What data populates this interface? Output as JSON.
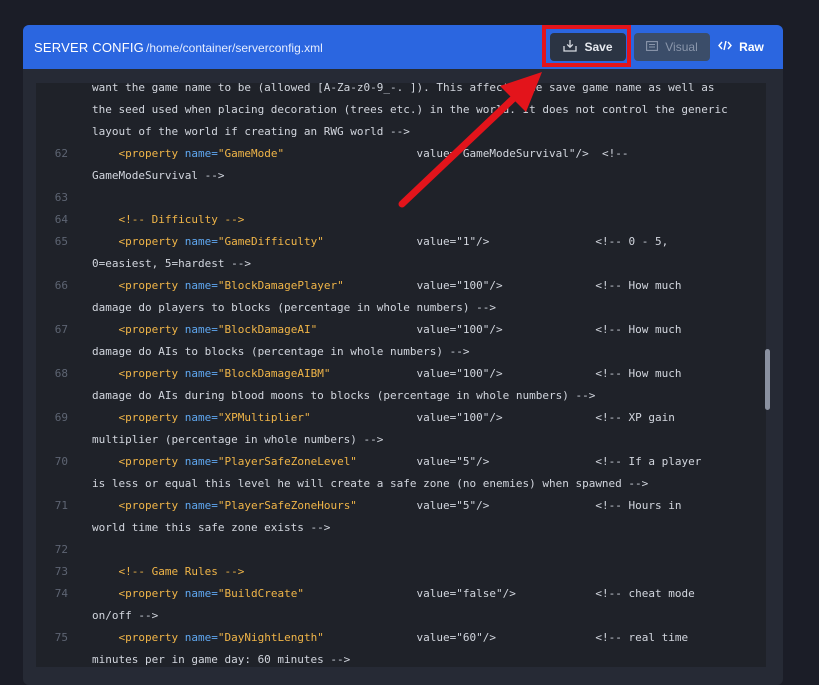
{
  "header": {
    "title": "SERVER CONFIG",
    "path": "/home/container/serverconfig.xml",
    "save_label": "Save",
    "visual_label": "Visual",
    "raw_label": "Raw"
  },
  "colors": {
    "header_bg": "#2b66e0",
    "highlight": "#e3141b",
    "tag": "#f0b548",
    "attr": "#5fa7f0"
  },
  "icons": [
    "save-icon",
    "visual-icon",
    "code-icon",
    "arrow-annotation"
  ],
  "lines": [
    {
      "num": "",
      "text": "want the game name to be (allowed [A-Za-z0-9_-. ]). This affects the save game name as well as"
    },
    {
      "num": "",
      "text": "the seed used when placing decoration (trees etc.) in the world. It does not control the generic"
    },
    {
      "num": "",
      "text": "layout of the world if creating an RWG world -->"
    },
    {
      "num": "62",
      "indent": "    ",
      "tag_open": "<property ",
      "attr": "name=",
      "name_val": "\"GameMode\"",
      "gap": "                    ",
      "value": "value=\"GameModeSurvival\"/>",
      "comment": "  <!--"
    },
    {
      "num": "",
      "text": "GameModeSurvival -->"
    },
    {
      "num": "63",
      "text": ""
    },
    {
      "num": "64",
      "indent": "    ",
      "section": "<!-- Difficulty -->"
    },
    {
      "num": "65",
      "indent": "    ",
      "tag_open": "<property ",
      "attr": "name=",
      "name_val": "\"GameDifficulty\"",
      "gap": "              ",
      "value": "value=\"1\"/>",
      "comment": "                <!-- 0 - 5,"
    },
    {
      "num": "",
      "text": "0=easiest, 5=hardest -->"
    },
    {
      "num": "66",
      "indent": "    ",
      "tag_open": "<property ",
      "attr": "name=",
      "name_val": "\"BlockDamagePlayer\"",
      "gap": "           ",
      "value": "value=\"100\"/>",
      "comment": "              <!-- How much"
    },
    {
      "num": "",
      "text": "damage do players to blocks (percentage in whole numbers) -->"
    },
    {
      "num": "67",
      "indent": "    ",
      "tag_open": "<property ",
      "attr": "name=",
      "name_val": "\"BlockDamageAI\"",
      "gap": "               ",
      "value": "value=\"100\"/>",
      "comment": "              <!-- How much"
    },
    {
      "num": "",
      "text": "damage do AIs to blocks (percentage in whole numbers) -->"
    },
    {
      "num": "68",
      "indent": "    ",
      "tag_open": "<property ",
      "attr": "name=",
      "name_val": "\"BlockDamageAIBM\"",
      "gap": "             ",
      "value": "value=\"100\"/>",
      "comment": "              <!-- How much"
    },
    {
      "num": "",
      "text": "damage do AIs during blood moons to blocks (percentage in whole numbers) -->"
    },
    {
      "num": "69",
      "indent": "    ",
      "tag_open": "<property ",
      "attr": "name=",
      "name_val": "\"XPMultiplier\"",
      "gap": "                ",
      "value": "value=\"100\"/>",
      "comment": "              <!-- XP gain"
    },
    {
      "num": "",
      "text": "multiplier (percentage in whole numbers) -->"
    },
    {
      "num": "70",
      "indent": "    ",
      "tag_open": "<property ",
      "attr": "name=",
      "name_val": "\"PlayerSafeZoneLevel\"",
      "gap": "         ",
      "value": "value=\"5\"/>",
      "comment": "                <!-- If a player"
    },
    {
      "num": "",
      "text": "is less or equal this level he will create a safe zone (no enemies) when spawned -->"
    },
    {
      "num": "71",
      "indent": "    ",
      "tag_open": "<property ",
      "attr": "name=",
      "name_val": "\"PlayerSafeZoneHours\"",
      "gap": "         ",
      "value": "value=\"5\"/>",
      "comment": "                <!-- Hours in"
    },
    {
      "num": "",
      "text": "world time this safe zone exists -->"
    },
    {
      "num": "72",
      "text": ""
    },
    {
      "num": "73",
      "indent": "    ",
      "section": "<!-- Game Rules -->"
    },
    {
      "num": "74",
      "indent": "    ",
      "tag_open": "<property ",
      "attr": "name=",
      "name_val": "\"BuildCreate\"",
      "gap": "                 ",
      "value": "value=\"false\"/>",
      "comment": "            <!-- cheat mode"
    },
    {
      "num": "",
      "text": "on/off -->"
    },
    {
      "num": "75",
      "indent": "    ",
      "tag_open": "<property ",
      "attr": "name=",
      "name_val": "\"DayNightLength\"",
      "gap": "              ",
      "value": "value=\"60\"/>",
      "comment": "               <!-- real time"
    },
    {
      "num": "",
      "text": "minutes per in game day: 60 minutes -->"
    }
  ]
}
